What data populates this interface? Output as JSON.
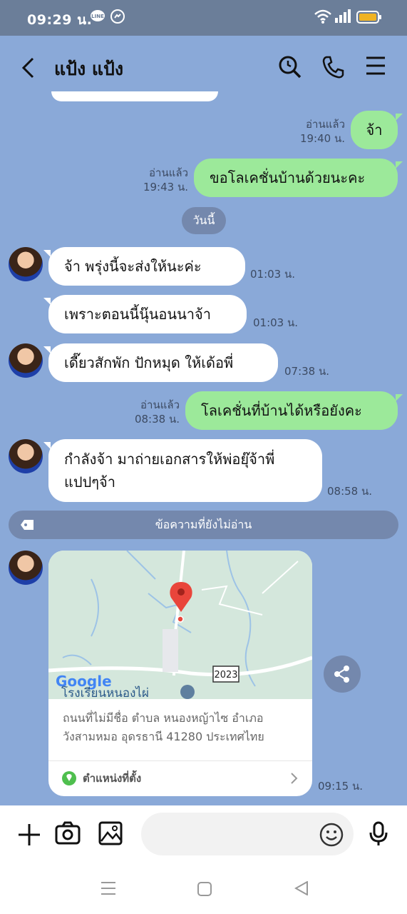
{
  "status_bar": {
    "time": "09:29 น.",
    "icons": [
      "line-icon",
      "messenger-icon",
      "wifi-icon",
      "signal-icon",
      "battery-icon"
    ],
    "battery_color": "#f0b323"
  },
  "header": {
    "back_icon": "chevron-left-icon",
    "title": "แป้ง แป้ง",
    "icons": [
      "search-icon",
      "phone-icon",
      "menu-icon"
    ]
  },
  "colors": {
    "chat_background": "#8aa9d8",
    "incoming_bubble": "#ffffff",
    "outgoing_bubble": "#9ce99a",
    "pill": "#7488ad",
    "status_bar": "#6b7e99"
  },
  "messages": [
    {
      "direction": "out",
      "text": "จ้า",
      "read": "อ่านแล้ว",
      "time": "19:40 น."
    },
    {
      "direction": "out",
      "text": "ขอโลเคชั่นบ้านด้วยนะคะ",
      "read": "อ่านแล้ว",
      "time": "19:43 น."
    },
    {
      "direction": "in",
      "text": "จ้า  พรุ่งนี้จะส่งให้นะค่ะ",
      "time": "01:03 น."
    },
    {
      "direction": "in",
      "text": "เพราะตอนนี้นุ๊นอนนาจ้า",
      "time": "01:03 น."
    },
    {
      "direction": "in",
      "text": "เดี๊ยวสักพัก ปักหมุด ให้เด้อพี่",
      "time": "07:38 น."
    },
    {
      "direction": "out",
      "text": "โลเคชั่นที่บ้านได้หรือยังคะ",
      "read": "อ่านแล้ว",
      "time": "08:38 น."
    },
    {
      "direction": "in",
      "text_line1": "กำลังจ้า มาถ่ายเอกสารให้พ่อยุ๊จ้าพี่",
      "text_line2": "แปปๆจ้า",
      "time": "08:58 น."
    }
  ],
  "date_separator": "วันนี้",
  "unread_label": "ข้อความที่ยังไม่อ่าน",
  "location": {
    "map_brand": "Google",
    "road_number": "2023",
    "place_label": "โรงเรียนหนองไผ่",
    "address_line1": "ถนนที่ไม่มีชื่อ ตำบล หนองหญ้าไซ อำเภอ",
    "address_line2": "วังสามหมอ อุดรธานี 41280 ประเทศไทย",
    "footer_label": "ตำแหน่งที่ตั้ง",
    "time": "09:15 น."
  },
  "input_bar": {
    "placeholder": "",
    "icons": [
      "plus-icon",
      "camera-icon",
      "image-icon",
      "emoji-icon",
      "microphone-icon"
    ]
  },
  "nav_bar": {
    "icons": [
      "recents-icon",
      "home-icon",
      "back-icon"
    ]
  }
}
